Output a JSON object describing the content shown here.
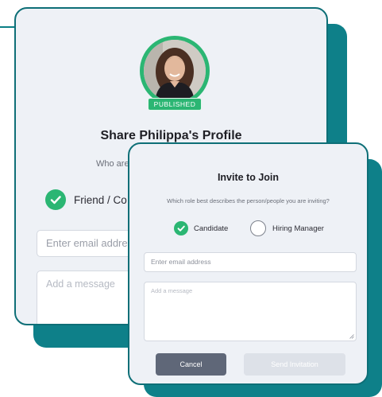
{
  "profile": {
    "status_badge": "PUBLISHED",
    "share_title": "Share Philippa's Profile",
    "who_prompt": "Who are",
    "relation_option": "Friend / Co",
    "email_placeholder": "Enter email addre",
    "message_placeholder": "Add a message"
  },
  "invite_modal": {
    "title": "Invite to Join",
    "subtitle": "Which role best describes the person/people you are inviting?",
    "roles": [
      {
        "label": "Candidate",
        "selected": true
      },
      {
        "label": "Hiring Manager",
        "selected": false
      }
    ],
    "email_placeholder": "Enter email address",
    "message_placeholder": "Add a message",
    "cancel_label": "Cancel",
    "send_label": "Send Invitation"
  },
  "colors": {
    "accent_green": "#2bb673",
    "teal": "#0e8089",
    "card_bg": "#eef1f6",
    "cancel_bg": "#5f6778",
    "disabled_bg": "#dde1e8"
  }
}
